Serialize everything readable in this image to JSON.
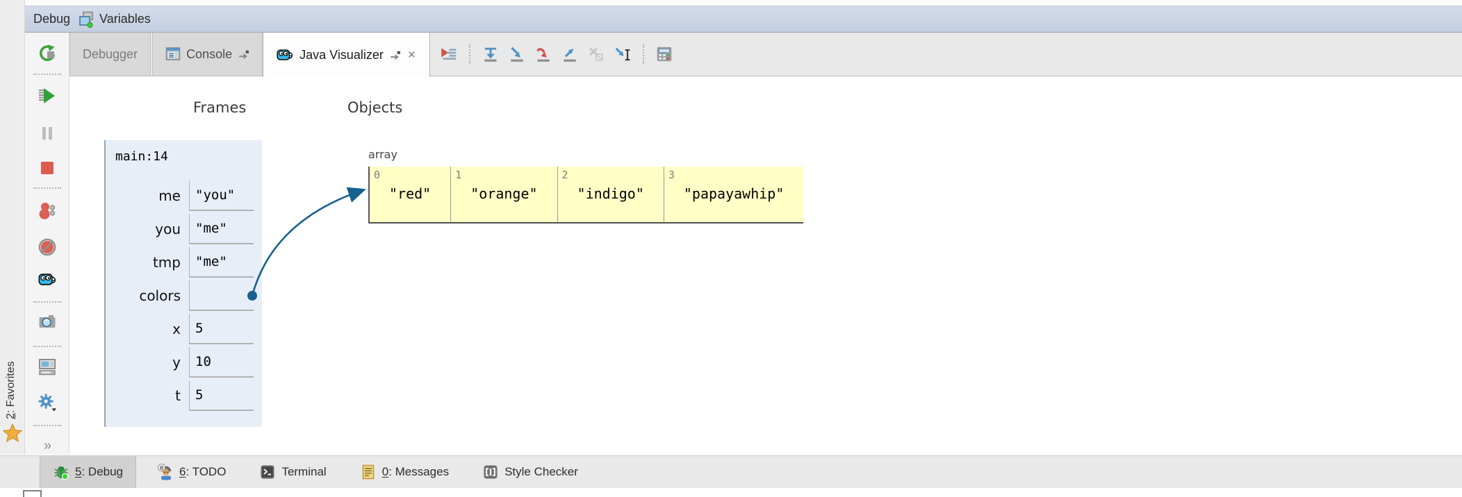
{
  "header": {
    "title": "Debug",
    "variables_tab": "Variables"
  },
  "tab_bar": {
    "tabs": [
      {
        "label": "Debugger"
      },
      {
        "label": "Console"
      },
      {
        "label": "Java Visualizer",
        "close_glyph": "×"
      }
    ],
    "more_glyph": "»"
  },
  "debug_toolbar_icons": [
    "show-execution-point",
    "step-over",
    "step-into",
    "force-step-into",
    "step-out",
    "drop-frame",
    "run-to-cursor",
    "evaluate-expression"
  ],
  "sidebar_icons": [
    "rerun",
    "resume-program",
    "pause-program",
    "stop",
    "view-breakpoints",
    "mute-breakpoints",
    "java-visualizer",
    "thread-dump",
    "restore-layout",
    "settings",
    "more"
  ],
  "favorites": {
    "mnemonic": "2",
    "rest": ": Favorites"
  },
  "visualizer": {
    "frames_heading": "Frames",
    "objects_heading": "Objects",
    "frame": {
      "title": "main:14",
      "vars": [
        {
          "name": "me",
          "value": "\"you\""
        },
        {
          "name": "you",
          "value": "\"me\""
        },
        {
          "name": "tmp",
          "value": "\"me\""
        },
        {
          "name": "colors",
          "value": ""
        },
        {
          "name": "x",
          "value": "5"
        },
        {
          "name": "y",
          "value": "10"
        },
        {
          "name": "t",
          "value": "5"
        }
      ]
    },
    "heap": {
      "type_label": "array",
      "cells": [
        {
          "index": "0",
          "value": "\"red\""
        },
        {
          "index": "1",
          "value": "\"orange\""
        },
        {
          "index": "2",
          "value": "\"indigo\""
        },
        {
          "index": "3",
          "value": "\"papayawhip\""
        }
      ]
    }
  },
  "statusbar": {
    "items": [
      {
        "icon": "debug-bug",
        "mnemonic": "5",
        "rest": ": Debug",
        "active": true
      },
      {
        "icon": "todo-person",
        "mnemonic": "6",
        "rest": ": TODO",
        "active": false
      },
      {
        "icon": "terminal",
        "mnemonic": "",
        "rest": "Terminal",
        "active": false
      },
      {
        "icon": "messages",
        "mnemonic": "0",
        "rest": ": Messages",
        "active": false
      },
      {
        "icon": "style-checker",
        "mnemonic": "",
        "rest": "Style Checker",
        "active": false
      }
    ]
  },
  "colors": {
    "arrow": "#17618e",
    "frame_bg": "#e7eef7",
    "heap_cell_bg": "#ffffc6",
    "active_tab_bg": "#fdfdfd"
  }
}
